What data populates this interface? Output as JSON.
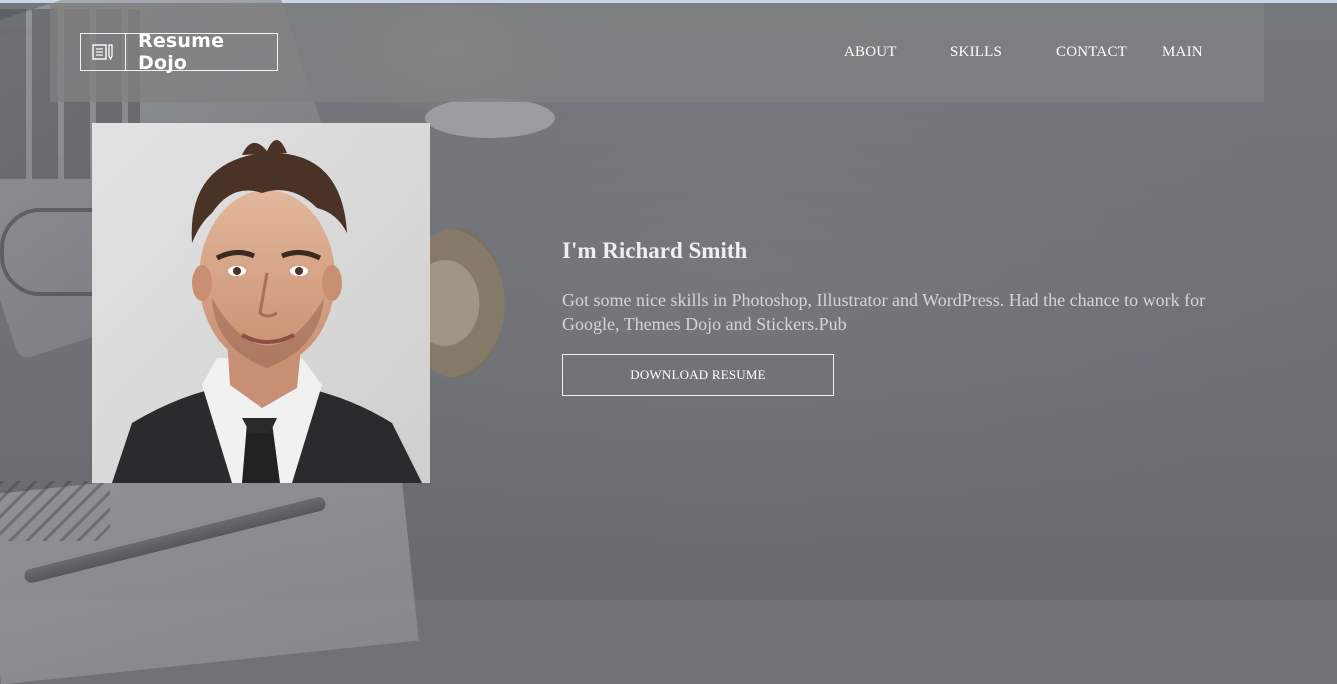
{
  "brand": {
    "name": "Resume Dojo",
    "icon": "notebook-pencil-icon"
  },
  "nav": {
    "items": [
      {
        "label": "ABOUT"
      },
      {
        "label": "SKILLS"
      },
      {
        "label": "CONTACT"
      },
      {
        "label": "MAIN"
      }
    ]
  },
  "profile": {
    "photo": "portrait-photo",
    "heading": "I'm Richard Smith",
    "bio": "Got some nice skills in Photoshop, Illustrator and WordPress. Had the chance to work for Google, Themes Dojo and Stickers.Pub",
    "download_label": "DOWNLOAD RESUME"
  },
  "colors": {
    "header_bg": "#808080",
    "text": "#ffffff",
    "page_bg": "#6f7378"
  }
}
